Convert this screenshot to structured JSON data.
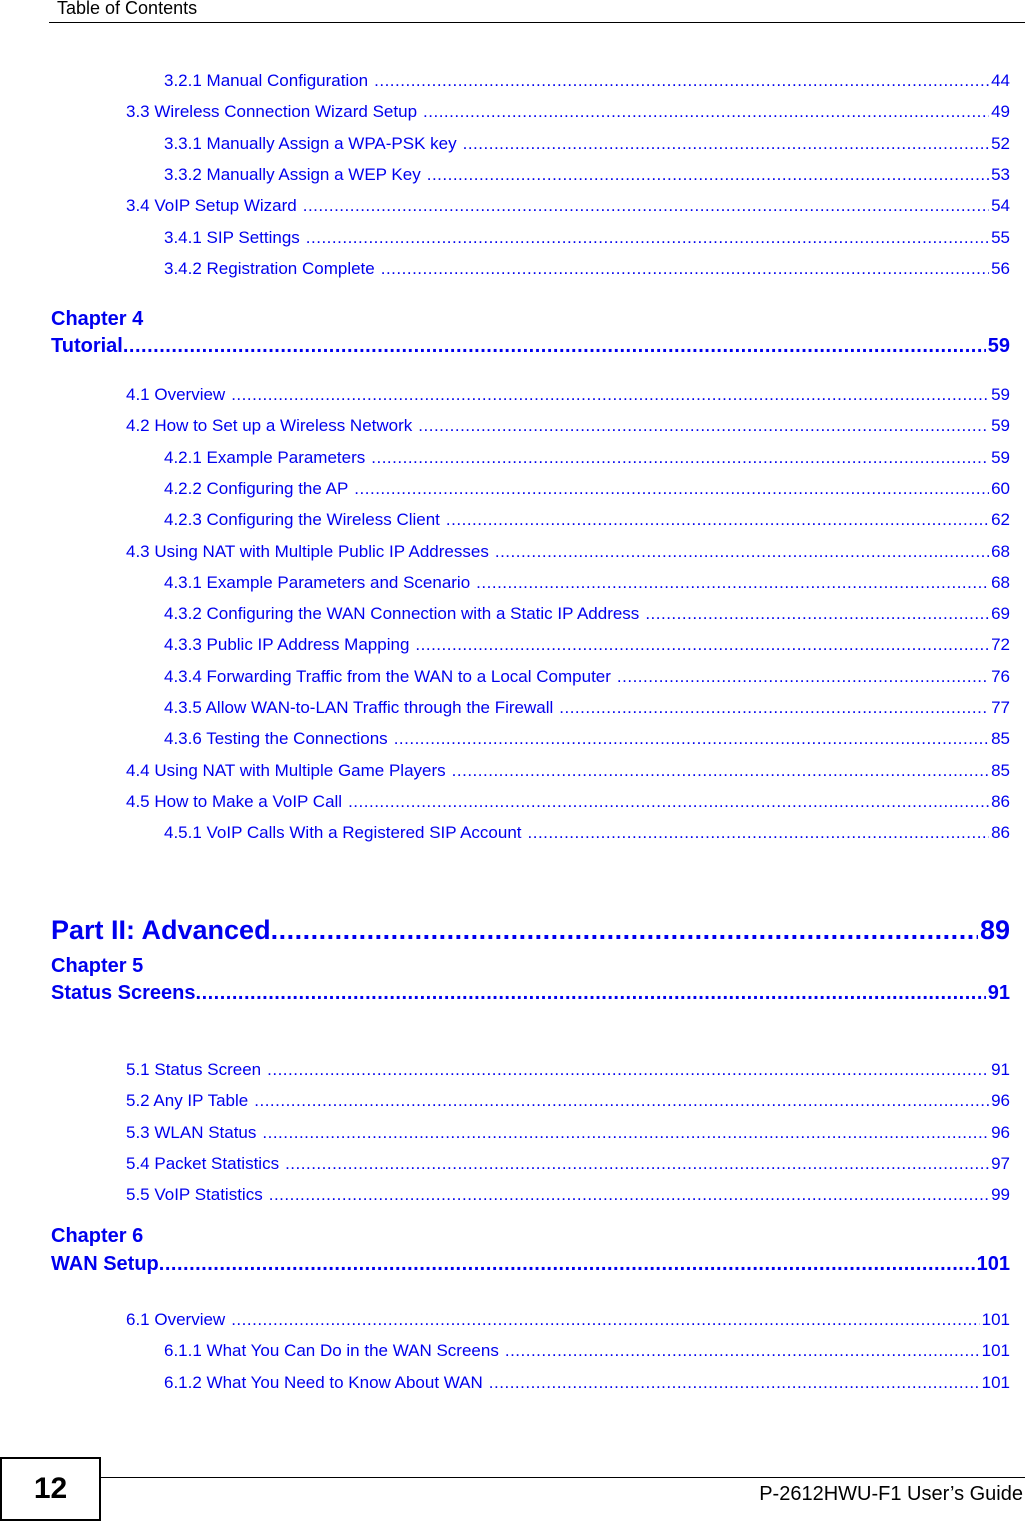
{
  "header": {
    "title": "Table of Contents"
  },
  "entries": [
    {
      "level": 2,
      "title": "3.2.1 Manual Configuration",
      "page": "44"
    },
    {
      "level": 1,
      "title": "3.3 Wireless Connection Wizard Setup",
      "page": "49"
    },
    {
      "level": 2,
      "title": "3.3.1 Manually Assign a WPA-PSK key",
      "page": "52"
    },
    {
      "level": 2,
      "title": "3.3.2 Manually Assign a WEP Key",
      "page": "53"
    },
    {
      "level": 1,
      "title": "3.4 VoIP Setup Wizard",
      "page": "54"
    },
    {
      "level": 2,
      "title": "3.4.1 SIP Settings",
      "page": "55"
    },
    {
      "level": 2,
      "title": "3.4.2 Registration Complete",
      "page": "56"
    }
  ],
  "chapter4": {
    "label": "Chapter  4",
    "title": "Tutorial",
    "page": "59",
    "entries": [
      {
        "level": 1,
        "title": "4.1 Overview",
        "page": "59"
      },
      {
        "level": 1,
        "title": "4.2 How to Set up a Wireless Network",
        "page": "59"
      },
      {
        "level": 2,
        "title": "4.2.1 Example Parameters",
        "page": "59"
      },
      {
        "level": 2,
        "title": "4.2.2 Configuring the AP",
        "page": "60"
      },
      {
        "level": 2,
        "title": "4.2.3 Configuring the Wireless Client",
        "page": "62"
      },
      {
        "level": 1,
        "title": "4.3 Using NAT with Multiple Public IP Addresses",
        "page": "68"
      },
      {
        "level": 2,
        "title": "4.3.1 Example Parameters and Scenario",
        "page": "68"
      },
      {
        "level": 2,
        "title": "4.3.2 Configuring the WAN Connection with a Static IP Address",
        "page": "69"
      },
      {
        "level": 2,
        "title": "4.3.3 Public IP Address Mapping",
        "page": "72"
      },
      {
        "level": 2,
        "title": "4.3.4 Forwarding Traffic from the WAN to a Local Computer",
        "page": "76"
      },
      {
        "level": 2,
        "title": "4.3.5 Allow WAN-to-LAN Traffic through the Firewall",
        "page": "77"
      },
      {
        "level": 2,
        "title": "4.3.6 Testing the Connections",
        "page": "85"
      },
      {
        "level": 1,
        "title": "4.4 Using NAT with Multiple Game Players",
        "page": "85"
      },
      {
        "level": 1,
        "title": "4.5 How to Make a VoIP Call",
        "page": "86"
      },
      {
        "level": 2,
        "title": "4.5.1 VoIP Calls With a Registered SIP Account",
        "page": "86"
      }
    ]
  },
  "part2": {
    "title": "Part II: Advanced",
    "page": "89"
  },
  "chapter5": {
    "label": "Chapter  5",
    "title": "Status Screens",
    "page": "91",
    "entries": [
      {
        "level": 1,
        "title": "5.1 Status Screen",
        "page": "91"
      },
      {
        "level": 1,
        "title": "5.2 Any IP Table",
        "page": "96"
      },
      {
        "level": 1,
        "title": "5.3 WLAN Status",
        "page": "96"
      },
      {
        "level": 1,
        "title": "5.4 Packet Statistics",
        "page": "97"
      },
      {
        "level": 1,
        "title": "5.5 VoIP Statistics",
        "page": "99"
      }
    ]
  },
  "chapter6": {
    "label": "Chapter  6",
    "title": "WAN Setup",
    "page": "101",
    "entries": [
      {
        "level": 1,
        "title": "6.1 Overview",
        "page": "101"
      },
      {
        "level": 2,
        "title": "6.1.1 What You Can Do in the WAN Screens",
        "page": "101"
      },
      {
        "level": 2,
        "title": "6.1.2 What You Need to Know About WAN",
        "page": "101"
      }
    ]
  },
  "footer": {
    "page_number": "12",
    "guide_title": "P-2612HWU-F1 User’s Guide"
  }
}
